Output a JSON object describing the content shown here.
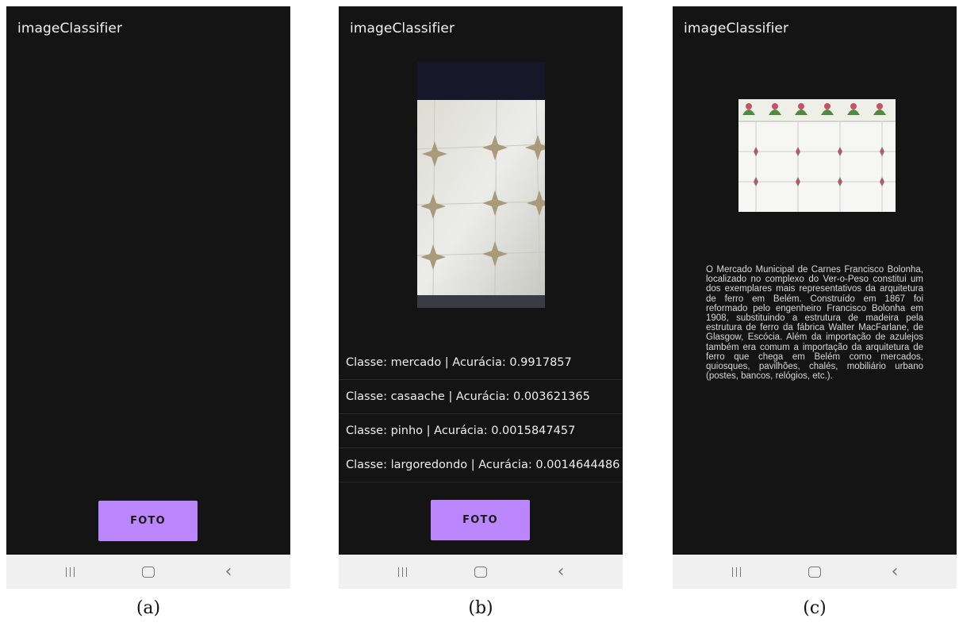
{
  "panels": {
    "a": {
      "app_title": "imageClassifier",
      "button_label": "FOTO",
      "caption": "(a)"
    },
    "b": {
      "app_title": "imageClassifier",
      "button_label": "FOTO",
      "caption": "(b)",
      "results": [
        "Classe: mercado  |  Acurácia: 0.9917857",
        "Classe: casaache  |  Acurácia: 0.003621365",
        "Classe: pinho  |  Acurácia: 0.0015847457",
        "Classe: largoredondo  |  Acurácia: 0.0014644486"
      ]
    },
    "c": {
      "app_title": "imageClassifier",
      "caption": "(c)",
      "description": "O Mercado Municipal de Carnes Francisco Bolonha, localizado no complexo do Ver-o-Peso constitui um dos exemplares mais representativos da arquitetura de ferro em Belém. Construído em 1867 foi reformado pelo engenheiro Francisco Bolonha em 1908, substituindo a estrutura de madeira pela estrutura de ferro da fábrica Walter MacFarlane, de Glasgow, Escócia. Além da importação de azulejos também era comum a importação da arquitetura de ferro que chega em Belém como mercados, quiosques, pavilhões, chalés, mobiliário urbano (postes, bancos, relógios, etc.)."
    }
  },
  "navbar": {
    "icons": [
      "recents-icon",
      "home-icon",
      "back-icon"
    ]
  },
  "colors": {
    "app_background": "#141414",
    "button": "#bb86fc",
    "navbar": "#f0f0f0"
  }
}
